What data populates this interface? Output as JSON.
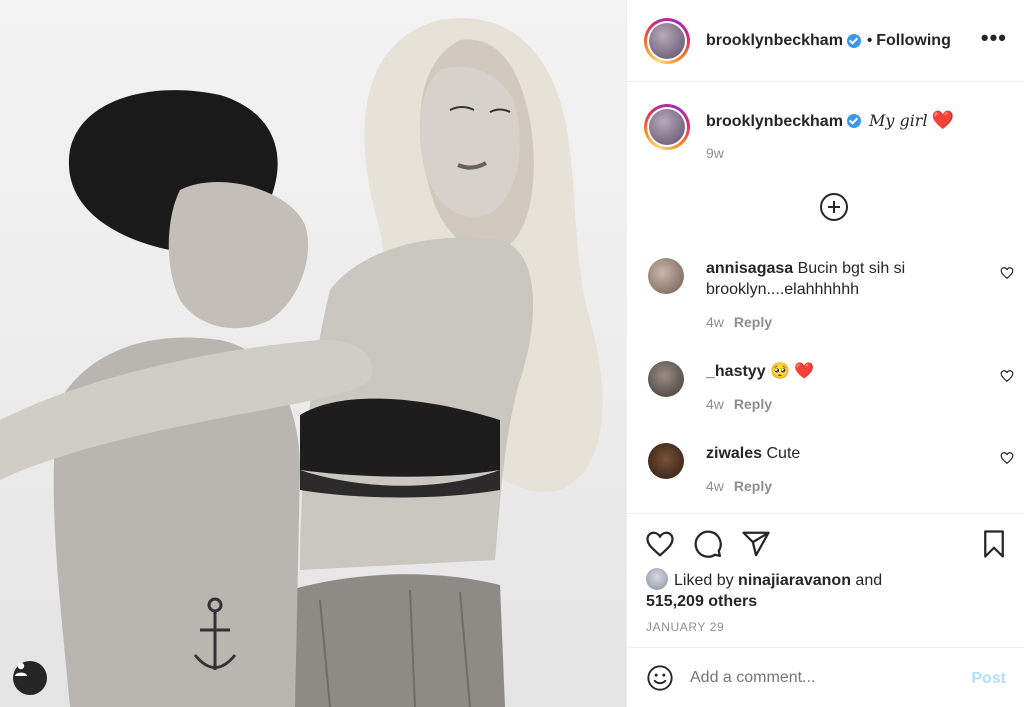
{
  "post": {
    "author": "brooklynbeckham",
    "follow_state": "Following",
    "separator": "•",
    "more_label": "•••",
    "caption_text": "My girl",
    "caption_emoji": "❤️",
    "caption_time": "9w"
  },
  "comments": [
    {
      "username": "annisagasa",
      "text": "Bucin bgt sih si brooklyn....elahhhhhh",
      "time": "4w",
      "reply": "Reply"
    },
    {
      "username": "_hastyy",
      "text": "🥺 ❤️",
      "time": "4w",
      "reply": "Reply"
    },
    {
      "username": "ziwales",
      "text": "Cute",
      "time": "4w",
      "reply": "Reply"
    }
  ],
  "likes": {
    "prefix": "Liked by",
    "user": "ninajiaravanon",
    "joiner": "and",
    "others": "515,209 others"
  },
  "date": "JANUARY 29",
  "composer": {
    "placeholder": "Add a comment...",
    "post_label": "Post"
  },
  "icons": [
    "like-icon",
    "comment-icon",
    "share-icon",
    "save-icon",
    "emoji-icon",
    "user-tag-icon",
    "load-more-comments-icon",
    "comment-like-icon",
    "verified-badge-icon"
  ],
  "colors": {
    "verified": "#3897f0",
    "post_disabled": "#b2dffc",
    "muted": "#8e8e8e",
    "heart": "#e0245e"
  }
}
